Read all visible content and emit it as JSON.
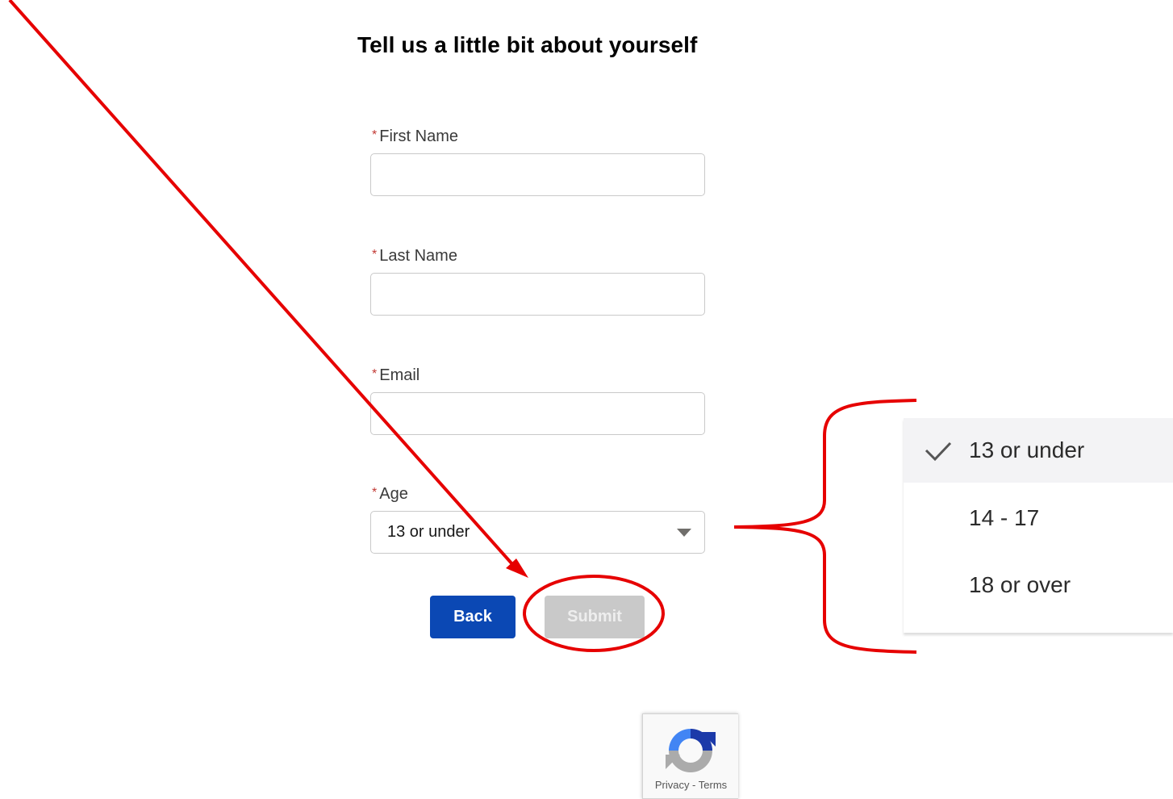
{
  "page": {
    "title": "Tell us a little bit about yourself"
  },
  "form": {
    "required_marker": "*",
    "first_name": {
      "label": "First Name",
      "value": ""
    },
    "last_name": {
      "label": "Last Name",
      "value": ""
    },
    "email": {
      "label": "Email",
      "value": ""
    },
    "age": {
      "label": "Age",
      "selected": "13 or under"
    }
  },
  "buttons": {
    "back": "Back",
    "submit": "Submit"
  },
  "dropdown": {
    "options": [
      {
        "label": "13 or under",
        "selected": true
      },
      {
        "label": "14 - 17",
        "selected": false
      },
      {
        "label": "18 or over",
        "selected": false
      }
    ]
  },
  "recaptcha": {
    "links": "Privacy - Terms"
  },
  "colors": {
    "annotation": "#e60000",
    "primary_button": "#0b48b4",
    "disabled_button": "#c9c9c9",
    "required": "#c23934"
  }
}
